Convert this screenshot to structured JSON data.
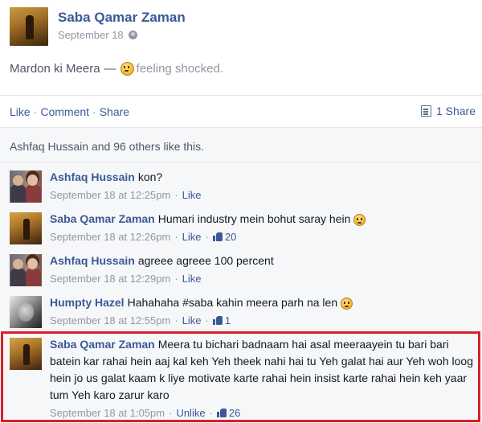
{
  "post": {
    "author": "Saba Qamar Zaman",
    "date": "September 18",
    "status_text": "Mardon ki Meera",
    "status_dash": "—",
    "feeling": "feeling shocked."
  },
  "actions": {
    "like": "Like",
    "comment": "Comment",
    "share": "Share",
    "separator": "·",
    "share_count": "1 Share"
  },
  "likes": {
    "names": "Ashfaq Hussain and 96 others",
    "suffix": " like this."
  },
  "comments": [
    {
      "name": "Ashfaq Hussain",
      "text": "kon?",
      "time": "September 18 at 12:25pm",
      "like_label": "Like",
      "likes": ""
    },
    {
      "name": "Saba Qamar Zaman",
      "text": "Humari industry mein bohut saray hein",
      "time": "September 18 at 12:26pm",
      "like_label": "Like",
      "likes": "20"
    },
    {
      "name": "Ashfaq Hussain",
      "text": "agreee agreee 100 percent",
      "time": "September 18 at 12:29pm",
      "like_label": "Like",
      "likes": ""
    },
    {
      "name": "Humpty Hazel",
      "text": "Hahahaha #saba kahin meera parh na len",
      "time": "September 18 at 12:55pm",
      "like_label": "Like",
      "likes": "1"
    },
    {
      "name": "Saba Qamar Zaman",
      "text": "Meera tu bichari badnaam hai asal meeraayein tu bari bari batein kar rahai hein aaj kal keh Yeh theek nahi hai tu Yeh galat hai aur Yeh woh loog hein jo us galat kaam k liye motivate karte rahai hein insist karte rahai hein keh yaar tum Yeh karo zarur karo",
      "time": "September 18 at 1:05pm",
      "like_label": "Unlike",
      "likes": "26"
    }
  ],
  "colors": {
    "link": "#3b5998",
    "meta": "#9197a3",
    "highlight": "#d7202a"
  }
}
